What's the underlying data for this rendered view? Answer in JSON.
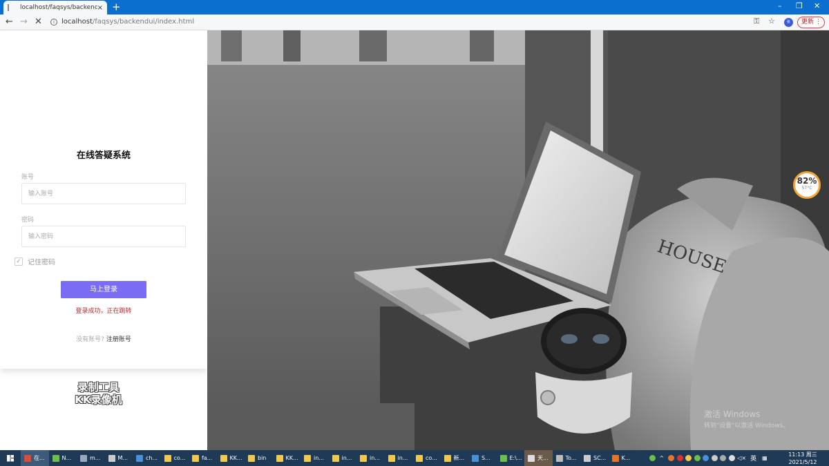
{
  "browser": {
    "tab_title": "localhost/faqsys/backendui/in",
    "tab_close": "×",
    "new_tab": "+",
    "url_host": "localhost",
    "url_path": "/faqsys/backendui/index.html",
    "update_label": "更新",
    "profile_initials": "张"
  },
  "login": {
    "title": "在线答疑系统",
    "account_label": "账号",
    "account_placeholder": "输入账号",
    "password_label": "密码",
    "password_placeholder": "输入密码",
    "remember_label": "记住密码",
    "submit_label": "马上登录",
    "status_message": "登录成功，正在跳转",
    "no_account_text": "没有账号?",
    "register_link": "注册账号"
  },
  "recorder_watermark": {
    "line1": "录制工具",
    "line2": "KK录像机"
  },
  "activation": {
    "line1": "激活 Windows",
    "line2": "转到\"设置\"以激活 Windows。"
  },
  "gauge": {
    "percent": "82%",
    "temp": "57°C"
  },
  "taskbar": {
    "items": [
      {
        "label": "在...",
        "color": "#e04a3a"
      },
      {
        "label": "N...",
        "color": "#6cc04a"
      },
      {
        "label": "m...",
        "color": "#9ab"
      },
      {
        "label": "M...",
        "color": "#ccc"
      },
      {
        "label": "ch...",
        "color": "#4a90d9"
      },
      {
        "label": "co...",
        "color": "#f2c94c"
      },
      {
        "label": "fa...",
        "color": "#f2c94c"
      },
      {
        "label": "KK...",
        "color": "#f2c94c"
      },
      {
        "label": "bin",
        "color": "#f2c94c"
      },
      {
        "label": "KK...",
        "color": "#f2c94c"
      },
      {
        "label": "in...",
        "color": "#f2c94c"
      },
      {
        "label": "in...",
        "color": "#f2c94c"
      },
      {
        "label": "in...",
        "color": "#f2c94c"
      },
      {
        "label": "in...",
        "color": "#f2c94c"
      },
      {
        "label": "co...",
        "color": "#f2c94c"
      },
      {
        "label": "新...",
        "color": "#f2c94c"
      },
      {
        "label": "S...",
        "color": "#4a90d9"
      },
      {
        "label": "E:\\...",
        "color": "#6cc04a"
      },
      {
        "label": "天...",
        "color": "#ddd"
      },
      {
        "label": "To...",
        "color": "#bbb"
      },
      {
        "label": "SC...",
        "color": "#ccc"
      },
      {
        "label": "K...",
        "color": "#e8742a"
      }
    ],
    "input_method": "英",
    "time": "11:13 周三",
    "date": "2021/5/12"
  }
}
